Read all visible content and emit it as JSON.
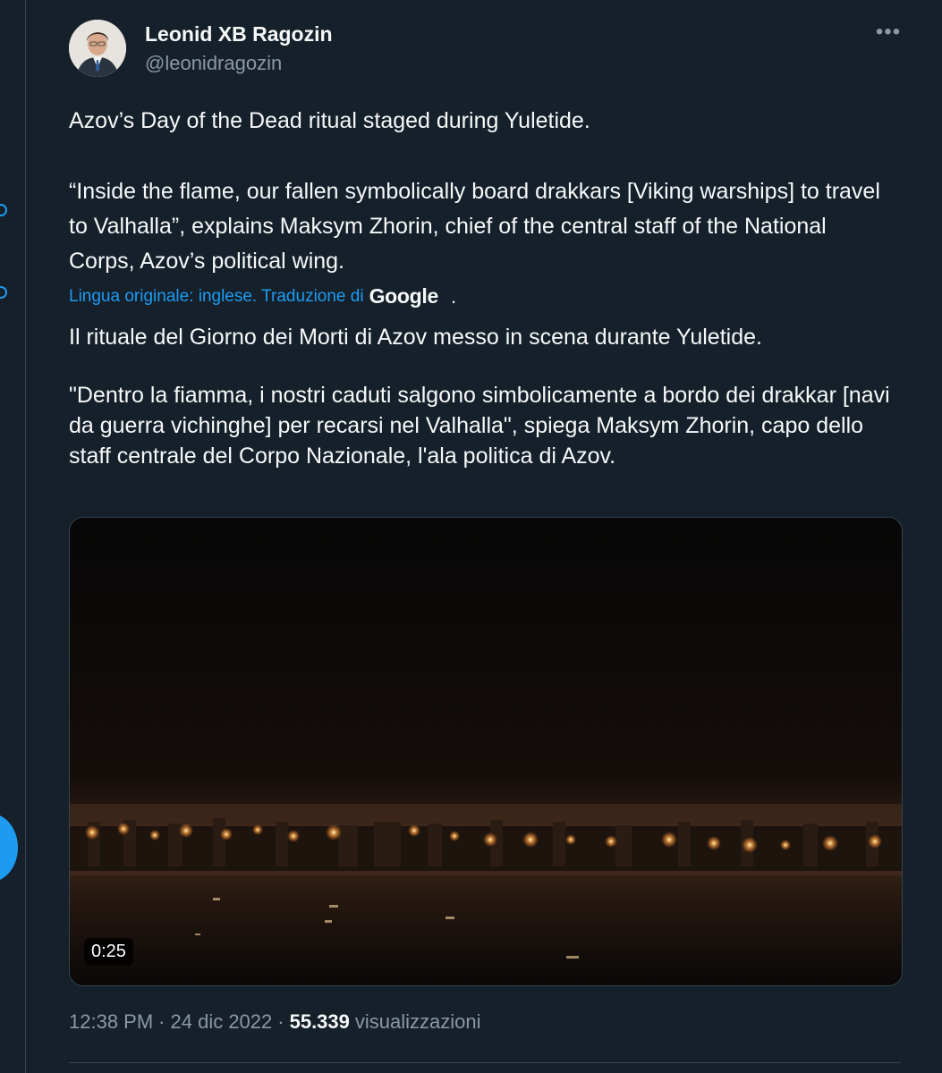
{
  "author": {
    "name": "Leonid XB Ragozin",
    "handle": "@leonidragozin",
    "more_icon": "more-horizontal-icon"
  },
  "tweet": {
    "paragraphs": [
      "Azov’s Day of the Dead ritual staged during Yuletide.",
      "“Inside the flame, our fallen symbolically board drakkars [Viking warships] to travel to Valhalla”, explains Maksym Zhorin, chief of the central staff of the National Corps, Azov’s political wing."
    ]
  },
  "translation": {
    "label": "Lingua originale: inglese. Traduzione di",
    "provider": "Google",
    "suffix": ".",
    "paragraphs": [
      "Il rituale del Giorno dei Morti di Azov messo in scena durante Yuletide.",
      "\"Dentro la fiamma, i nostri caduti salgono simbolicamente a bordo dei drakkar [navi da guerra vichinghe] per recarsi nel Valhalla\", spiega Maksym Zhorin, capo dello staff centrale del Corpo Nazionale, l'ala politica di Azov."
    ]
  },
  "media": {
    "duration": "0:25"
  },
  "meta": {
    "time": "12:38 PM",
    "separator": "·",
    "date": "24 dic 2022",
    "views_count": "55.339",
    "views_label": "visualizzazioni"
  },
  "colors": {
    "background": "#15202b",
    "text": "#f7f9f9",
    "secondary_text": "#8b98a5",
    "accent": "#1d9bf0",
    "border": "#38444d"
  }
}
